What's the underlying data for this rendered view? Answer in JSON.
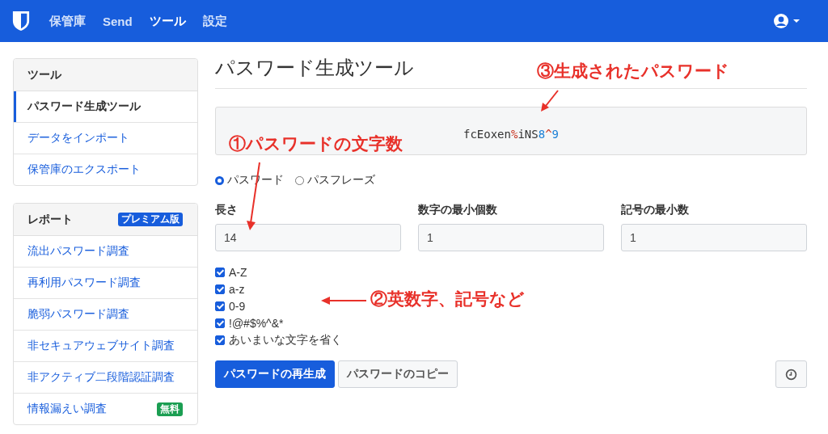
{
  "nav": {
    "items": [
      {
        "label": "保管庫",
        "selected": false
      },
      {
        "label": "Send",
        "selected": false
      },
      {
        "label": "ツール",
        "selected": true
      },
      {
        "label": "設定",
        "selected": false
      }
    ]
  },
  "sidebar": {
    "sections": [
      {
        "title": "ツール",
        "items": [
          {
            "label": "パスワード生成ツール",
            "selected": true
          },
          {
            "label": "データをインポート",
            "selected": false
          },
          {
            "label": "保管庫のエクスポート",
            "selected": false
          }
        ]
      },
      {
        "title": "レポート",
        "badge": {
          "text": "プレミアム版",
          "kind": "premium"
        },
        "items": [
          {
            "label": "流出パスワード調査",
            "selected": false
          },
          {
            "label": "再利用パスワード調査",
            "selected": false
          },
          {
            "label": "脆弱パスワード調査",
            "selected": false
          },
          {
            "label": "非セキュアウェブサイト調査",
            "selected": false
          },
          {
            "label": "非アクティブ二段階認証調査",
            "selected": false
          },
          {
            "label": "情報漏えい調査",
            "selected": false,
            "badge": {
              "text": "無料",
              "kind": "free"
            }
          }
        ]
      }
    ]
  },
  "page_title": "パスワード生成ツール",
  "password": [
    {
      "text": "fcEoxen",
      "kind": "letter"
    },
    {
      "text": "%",
      "kind": "special"
    },
    {
      "text": "iNS",
      "kind": "letter"
    },
    {
      "text": "8",
      "kind": "number"
    },
    {
      "text": "^",
      "kind": "special"
    },
    {
      "text": "9",
      "kind": "number"
    }
  ],
  "type_options": [
    {
      "label": "パスワード",
      "selected": true
    },
    {
      "label": "パスフレーズ",
      "selected": false
    }
  ],
  "fields": [
    {
      "label": "長さ",
      "value": "14"
    },
    {
      "label": "数字の最小個数",
      "value": "1"
    },
    {
      "label": "記号の最小数",
      "value": "1"
    }
  ],
  "options": [
    {
      "label": "A-Z",
      "checked": true
    },
    {
      "label": "a-z",
      "checked": true
    },
    {
      "label": "0-9",
      "checked": true
    },
    {
      "label": "!@#$%^&*",
      "checked": true
    },
    {
      "label": "あいまいな文字を省く",
      "checked": true
    }
  ],
  "buttons": [
    {
      "label": "パスワードの再生成",
      "kind": "primary"
    },
    {
      "label": "パスワードのコピー",
      "kind": "secondary"
    }
  ],
  "annotations": [
    {
      "text": "①パスワードの文字数"
    },
    {
      "text": "②英数字、記号など"
    },
    {
      "text": "③生成されたパスワード"
    }
  ]
}
